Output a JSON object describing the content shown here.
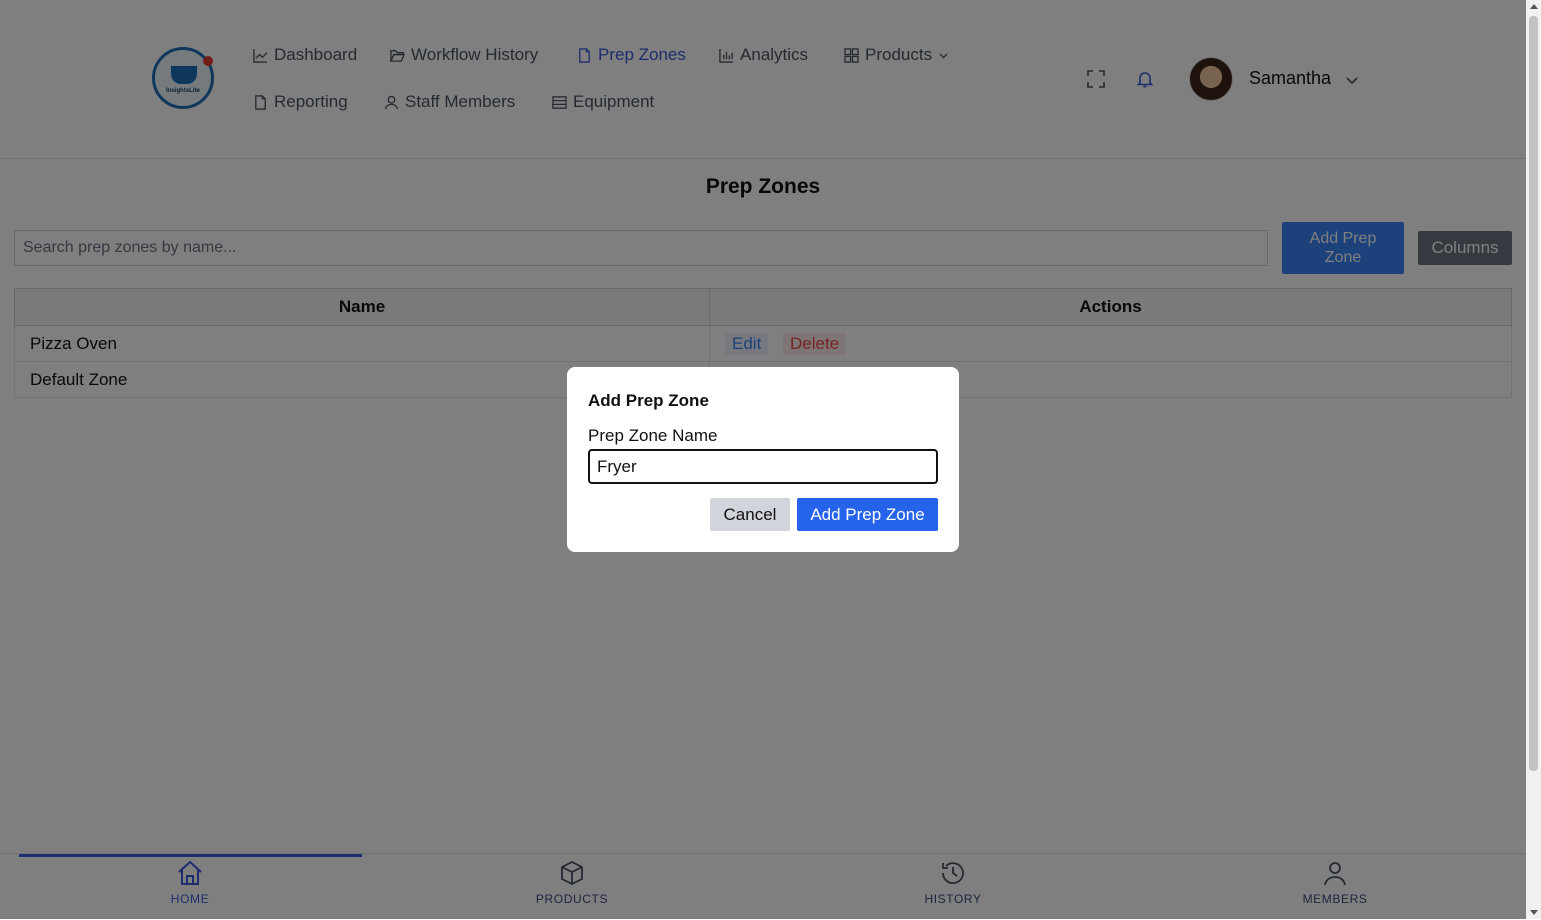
{
  "header": {
    "logo_text": "InsightsLite",
    "nav": [
      {
        "label": "Dashboard",
        "icon": "chart-line-icon"
      },
      {
        "label": "Workflow History",
        "icon": "folder-open-icon"
      },
      {
        "label": "Prep Zones",
        "icon": "document-icon",
        "active": true
      },
      {
        "label": "Analytics",
        "icon": "bar-chart-icon"
      },
      {
        "label": "Products",
        "icon": "grid-icon",
        "has_dropdown": true
      },
      {
        "label": "Reporting",
        "icon": "document-icon"
      },
      {
        "label": "Staff Members",
        "icon": "user-icon"
      },
      {
        "label": "Equipment",
        "icon": "list-icon"
      }
    ],
    "user": {
      "name": "Samantha"
    }
  },
  "page": {
    "title": "Prep Zones",
    "search_placeholder": "Search prep zones by name...",
    "add_button": "Add Prep Zone",
    "columns_button": "Columns",
    "table": {
      "headers": [
        "Name",
        "Actions"
      ],
      "rows": [
        {
          "name": "Pizza Oven",
          "actions": [
            "Edit",
            "Delete"
          ]
        },
        {
          "name": "Default Zone",
          "actions": []
        }
      ]
    }
  },
  "modal": {
    "title": "Add Prep Zone",
    "label": "Prep Zone Name",
    "input_value": "Fryer",
    "cancel": "Cancel",
    "submit": "Add Prep Zone"
  },
  "tabbar": {
    "tabs": [
      {
        "label": "HOME",
        "icon": "home-icon",
        "active": true
      },
      {
        "label": "PRODUCTS",
        "icon": "box-icon"
      },
      {
        "label": "HISTORY",
        "icon": "history-icon"
      },
      {
        "label": "MEMBERS",
        "icon": "user-icon"
      }
    ]
  },
  "colors": {
    "accent": "#3b5bdb",
    "primary_button": "#2563eb",
    "delete": "#ef4444"
  }
}
